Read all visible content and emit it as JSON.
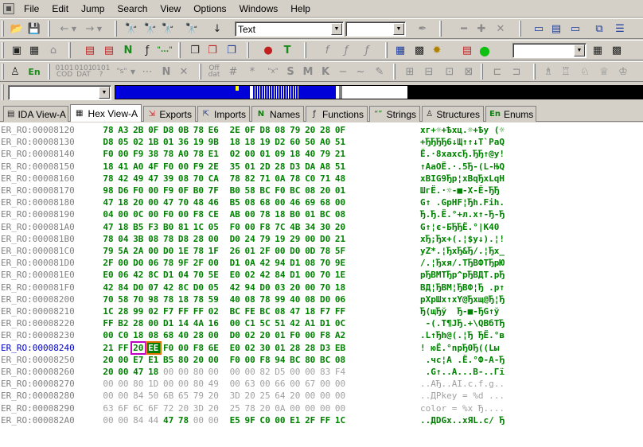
{
  "menu": [
    "File",
    "Edit",
    "Jump",
    "Search",
    "View",
    "Options",
    "Windows",
    "Help"
  ],
  "toolbar": {
    "text_combo": "Text",
    "second_combo": "",
    "third_combo": "",
    "nav_combo": ""
  },
  "tabs": [
    {
      "label": "IDA View-A",
      "icon": "document-icon"
    },
    {
      "label": "Hex View-A",
      "icon": "hex-view-icon",
      "active": true
    },
    {
      "label": "Exports",
      "icon": "exports-icon"
    },
    {
      "label": "Imports",
      "icon": "imports-icon"
    },
    {
      "label": "Names",
      "icon": "names-icon"
    },
    {
      "label": "Functions",
      "icon": "functions-icon"
    },
    {
      "label": "Strings",
      "icon": "strings-icon"
    },
    {
      "label": "Structures",
      "icon": "structures-icon"
    },
    {
      "label": "Enums",
      "icon": "enums-icon"
    }
  ],
  "hex": {
    "cursor_row_index": 9,
    "rows": [
      {
        "addr": "ER_RO:00008120",
        "bytes": [
          "78",
          "A3",
          "2B",
          "0F",
          "D8",
          "0B",
          "78",
          "E6",
          "2E",
          "0F",
          "D8",
          "08",
          "79",
          "20",
          "28",
          "0F"
        ],
        "ascii": "xг+☼+Ѣxц.☼+Ѣу (☼"
      },
      {
        "addr": "ER_RO:00008130",
        "bytes": [
          "D8",
          "05",
          "02",
          "1B",
          "01",
          "36",
          "19",
          "9B",
          "18",
          "18",
          "19",
          "D2",
          "60",
          "50",
          "A0",
          "51"
        ],
        "ascii": "+ЂЂЂЂ6↓Щ↑↑↓Т`PaQ"
      },
      {
        "addr": "ER_RO:00008140",
        "bytes": [
          "F0",
          "00",
          "F9",
          "38",
          "78",
          "A0",
          "78",
          "E1",
          "02",
          "00",
          "01",
          "09",
          "18",
          "40",
          "79",
          "21"
        ],
        "ascii": "Ё.·8xaxcЂ.ЂЂ↑@у!"
      },
      {
        "addr": "ER_RO:00008150",
        "bytes": [
          "18",
          "41",
          "A0",
          "4F",
          "F0",
          "00",
          "F9",
          "2E",
          "35",
          "01",
          "2D",
          "28",
          "D3",
          "DA",
          "A8",
          "51"
        ],
        "ascii": "↑AaOЁ.·.5Ђ-(L-ЊQ"
      },
      {
        "addr": "ER_RO:00008160",
        "bytes": [
          "78",
          "42",
          "49",
          "47",
          "39",
          "08",
          "70",
          "CA",
          "78",
          "82",
          "71",
          "0A",
          "78",
          "C0",
          "71",
          "48"
        ],
        "ascii": "xBIG9Ђр¦xBqЂxLqH"
      },
      {
        "addr": "ER_RO:00008170",
        "bytes": [
          "98",
          "D6",
          "F0",
          "00",
          "F9",
          "0F",
          "B0",
          "7F",
          "B0",
          "58",
          "BC",
          "F0",
          "BC",
          "08",
          "20",
          "01"
        ],
        "ascii": "ШгЁ.·☼-■-X-Ё-ЂЂ"
      },
      {
        "addr": "ER_RO:00008180",
        "bytes": [
          "47",
          "18",
          "20",
          "00",
          "47",
          "70",
          "48",
          "46",
          "B5",
          "08",
          "68",
          "00",
          "46",
          "69",
          "68",
          "00"
        ],
        "ascii": "G↑ .GpHF¦Ђh.Fih."
      },
      {
        "addr": "ER_RO:00008190",
        "bytes": [
          "04",
          "00",
          "0C",
          "00",
          "F0",
          "00",
          "F8",
          "CE",
          "AB",
          "00",
          "78",
          "18",
          "B0",
          "01",
          "BC",
          "08"
        ],
        "ascii": "Ђ.Ђ.Ё.°+л.x↑-Ђ-Ђ"
      },
      {
        "addr": "ER_RO:000081A0",
        "bytes": [
          "47",
          "18",
          "B5",
          "F3",
          "B0",
          "81",
          "1C",
          "05",
          "F0",
          "00",
          "F8",
          "7C",
          "4B",
          "34",
          "30",
          "20"
        ],
        "ascii": "G↑¦є-БЂЂЁ.°|K40 "
      },
      {
        "addr": "ER_RO:000081B0",
        "bytes": [
          "78",
          "04",
          "3B",
          "08",
          "78",
          "D8",
          "28",
          "00",
          "D0",
          "24",
          "79",
          "19",
          "29",
          "00",
          "D0",
          "21"
        ],
        "ascii": "xЂ;Ђx+(.¦$у↓).¦!"
      },
      {
        "addr": "ER_RO:000081C0",
        "bytes": [
          "79",
          "5A",
          "2A",
          "00",
          "D0",
          "1E",
          "78",
          "1F",
          "26",
          "01",
          "2F",
          "00",
          "D0",
          "0D",
          "78",
          "5F"
        ],
        "ascii": "yZ*.¦ЂxЂ&Ђ/.¦Ђx_"
      },
      {
        "addr": "ER_RO:000081D0",
        "bytes": [
          "2F",
          "00",
          "D0",
          "06",
          "78",
          "9F",
          "2F",
          "00",
          "D1",
          "0A",
          "42",
          "94",
          "D1",
          "08",
          "70",
          "9E"
        ],
        "ascii": "/.¦Ђxя/.ТЂBФТЂрЮ"
      },
      {
        "addr": "ER_RO:000081E0",
        "bytes": [
          "E0",
          "06",
          "42",
          "8C",
          "D1",
          "04",
          "70",
          "5E",
          "E0",
          "02",
          "42",
          "84",
          "D1",
          "00",
          "70",
          "1E"
        ],
        "ascii": "рЂBМТЂр^рЂBДТ.рЂ"
      },
      {
        "addr": "ER_RO:000081F0",
        "bytes": [
          "42",
          "84",
          "D0",
          "07",
          "42",
          "8C",
          "D0",
          "05",
          "42",
          "94",
          "D0",
          "03",
          "20",
          "00",
          "70",
          "18"
        ],
        "ascii": "BД¦ЂBМ¦ЂBФ¦Ђ .р↑"
      },
      {
        "addr": "ER_RO:00008200",
        "bytes": [
          "70",
          "58",
          "70",
          "98",
          "78",
          "18",
          "78",
          "59",
          "40",
          "08",
          "78",
          "99",
          "40",
          "08",
          "D0",
          "06"
        ],
        "ascii": "pXpШx↑xY@Ђxщ@Ђ¦Ђ"
      },
      {
        "addr": "ER_RO:00008210",
        "bytes": [
          "1C",
          "28",
          "99",
          "02",
          "F7",
          "FF",
          "FF",
          "02",
          "BC",
          "FE",
          "BC",
          "08",
          "47",
          "18",
          "F7",
          "FF"
        ],
        "ascii": "Ђ(щЂў  Ђ-■-ЂG↑ў "
      },
      {
        "addr": "ER_RO:00008220",
        "bytes": [
          "FF",
          "B2",
          "28",
          "00",
          "D1",
          "14",
          "4A",
          "16",
          "00",
          "C1",
          "5C",
          "51",
          "42",
          "A1",
          "D1",
          "0C"
        ],
        "ascii": " -(.Т¶JЂ.+\\QBбТЂ"
      },
      {
        "addr": "ER_RO:00008230",
        "bytes": [
          "00",
          "C0",
          "18",
          "08",
          "68",
          "40",
          "28",
          "00",
          "D0",
          "02",
          "20",
          "01",
          "F0",
          "00",
          "F8",
          "A2"
        ],
        "ascii": ".L↑Ђh@(.¦Ђ ЂЁ.°в"
      },
      {
        "addr": "ER_RO:00008240",
        "bytes": [
          "21",
          "FF",
          "20",
          "EE",
          "F0",
          "00",
          "F8",
          "6E",
          "E0",
          "02",
          "30",
          "01",
          "28",
          "28",
          "D3",
          "EB"
        ],
        "ascii": "! юЁ.°nрЂ0Ђ((Lы",
        "cur": true
      },
      {
        "addr": "ER_RO:00008250",
        "bytes": [
          "20",
          "00",
          "E7",
          "E1",
          "B5",
          "80",
          "20",
          "00",
          "F0",
          "00",
          "F8",
          "94",
          "BC",
          "80",
          "BC",
          "08"
        ],
        "ascii": " .чс¦А .Ё.°Ф-А-Ђ"
      },
      {
        "addr": "ER_RO:00008260",
        "bytes": [
          "20",
          "00",
          "47",
          "18",
          "00",
          "00",
          "80",
          "00",
          "00",
          "00",
          "82",
          "D5",
          "00",
          "00",
          "83",
          "F4"
        ],
        "ascii": " .G↑..А...В-..Гї",
        "gray_from": 4
      },
      {
        "addr": "ER_RO:00008270",
        "bytes": [
          "00",
          "00",
          "80",
          "1D",
          "00",
          "00",
          "80",
          "49",
          "00",
          "63",
          "00",
          "66",
          "00",
          "67",
          "00",
          "00"
        ],
        "ascii": "..АЂ..АI.c.f.g..",
        "gray_from": 0
      },
      {
        "addr": "ER_RO:00008280",
        "bytes": [
          "00",
          "00",
          "84",
          "50",
          "6B",
          "65",
          "79",
          "20",
          "3D",
          "20",
          "25",
          "64",
          "20",
          "00",
          "00",
          "00"
        ],
        "ascii": "..ДPkey = %d ...",
        "gray_from": 0
      },
      {
        "addr": "ER_RO:00008290",
        "bytes": [
          "63",
          "6F",
          "6C",
          "6F",
          "72",
          "20",
          "3D",
          "20",
          "25",
          "78",
          "20",
          "0A",
          "00",
          "00",
          "00",
          "00"
        ],
        "ascii": "color = %x Ђ....",
        "gray_from": 0
      },
      {
        "addr": "ER_RO:000082A0",
        "bytes": [
          "00",
          "00",
          "84",
          "44",
          "47",
          "78",
          "00",
          "00",
          "E5",
          "9F",
          "C0",
          "00",
          "E1",
          "2F",
          "FF",
          "1C"
        ],
        "ascii": "..ДDGx..хЯL.с/ Ђ",
        "mixed": true
      }
    ]
  }
}
